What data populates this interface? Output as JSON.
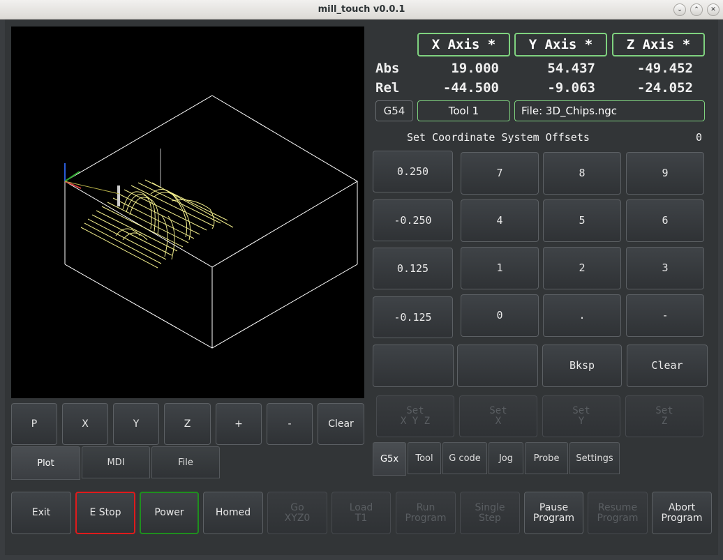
{
  "window": {
    "title": "mill_touch v0.0.1",
    "controls": [
      "⌄",
      "⌃",
      "✕"
    ]
  },
  "plot_buttons": [
    "P",
    "X",
    "Y",
    "Z",
    "+",
    "-",
    "Clear"
  ],
  "left_tabs": [
    "Plot",
    "MDI",
    "File"
  ],
  "axes": {
    "headers": [
      "X Axis *",
      "Y Axis *",
      "Z Axis *"
    ],
    "abs_label": "Abs",
    "rel_label": "Rel",
    "abs": [
      "19.000",
      "54.437",
      "-49.452"
    ],
    "rel": [
      "-44.500",
      "-9.063",
      "-24.052"
    ]
  },
  "status": {
    "coord_system": "G54",
    "tool": "Tool 1",
    "file": "File: 3D_Chips.ngc"
  },
  "offsets": {
    "title": "Set Coordinate System Offsets",
    "value": "0"
  },
  "increments": [
    "0.250",
    "-0.250",
    "0.125",
    "-0.125"
  ],
  "keypad": {
    "row1": [
      "7",
      "8",
      "9"
    ],
    "row2": [
      "4",
      "5",
      "6"
    ],
    "row3": [
      "1",
      "2",
      "3"
    ],
    "row4": [
      "0",
      ".",
      "-"
    ],
    "row5": [
      "",
      "",
      "Bksp",
      "Clear"
    ]
  },
  "set_buttons": [
    [
      "Set",
      "X Y Z"
    ],
    [
      "Set",
      "X"
    ],
    [
      "Set",
      "Y"
    ],
    [
      "Set",
      "Z"
    ]
  ],
  "right_tabs": [
    "G5x",
    "Tool",
    "G code",
    "Jog",
    "Probe",
    "Settings"
  ],
  "bottom_buttons": [
    [
      "Exit",
      ""
    ],
    [
      "E Stop",
      ""
    ],
    [
      "Power",
      ""
    ],
    [
      "Homed",
      ""
    ],
    [
      "Go",
      "XYZ0"
    ],
    [
      "Load",
      "T1"
    ],
    [
      "Run",
      "Program"
    ],
    [
      "Single",
      "Step"
    ],
    [
      "Pause",
      "Program"
    ],
    [
      "Resume",
      "Program"
    ],
    [
      "Abort",
      "Program"
    ]
  ],
  "colors": {
    "estop_border": "#e01b1b",
    "power_border": "#1f8f1f",
    "axis_box_border": "#7fd27f",
    "toolpath": "#f2ee8c"
  }
}
